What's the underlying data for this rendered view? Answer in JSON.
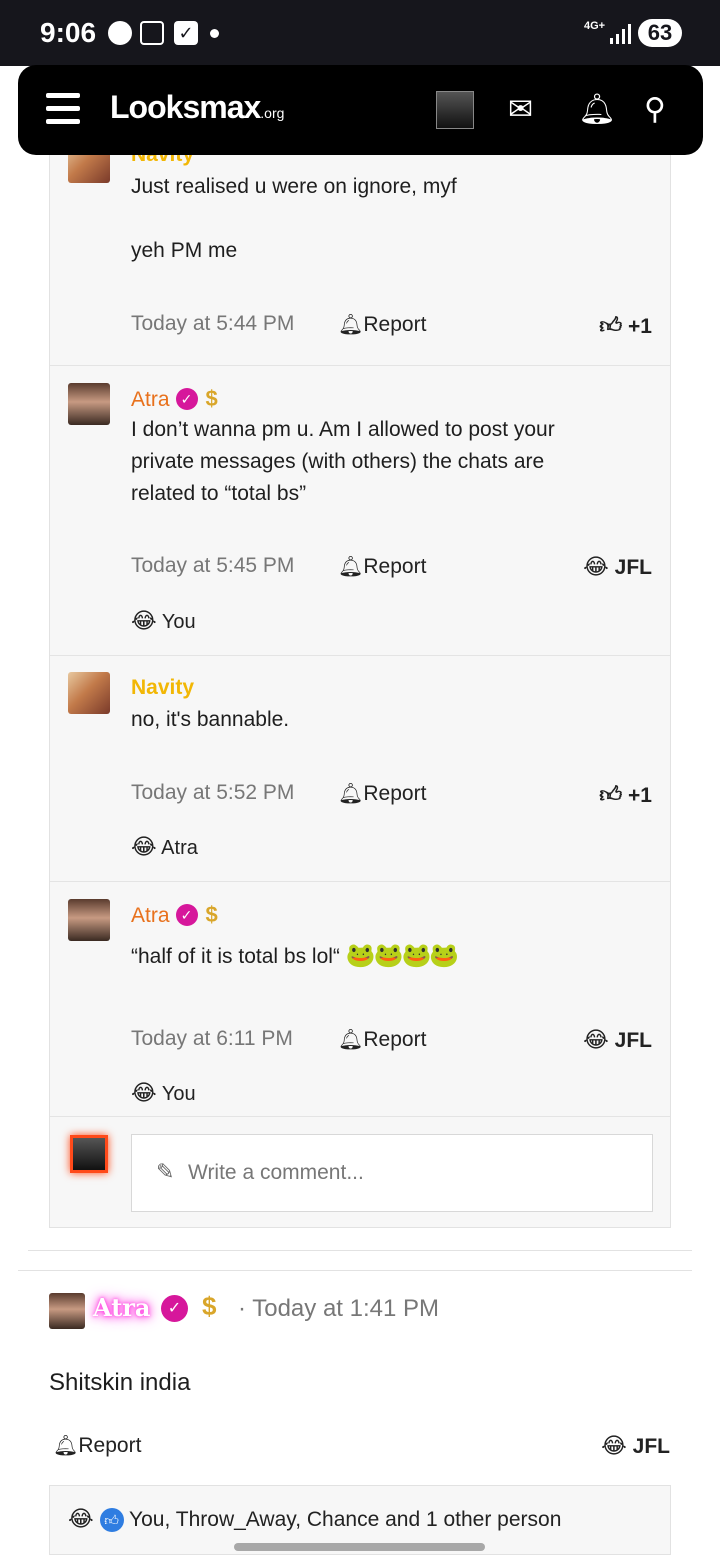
{
  "status_bar": {
    "time": "9:06",
    "network": "4G+",
    "battery": "63"
  },
  "nav": {
    "logo_main": "Looksmax",
    "logo_suffix": ".org",
    "icons": [
      "menu-icon",
      "avatar",
      "envelope-icon",
      "bell-icon",
      "search-icon"
    ]
  },
  "comments": [
    {
      "author": "Navity",
      "body": [
        "Just realised u were on ignore, myf",
        "",
        "yeh PM me"
      ],
      "time": "Today at 5:44 PM",
      "report": "Report",
      "reaction": "+1"
    },
    {
      "author": "Atra",
      "body": [
        "I don’t wanna pm u. Am I allowed to post your",
        "private messages (with others) the chats are",
        "related to “total bs”"
      ],
      "time": "Today at 5:45 PM",
      "report": "Report",
      "reaction": "JFL",
      "reacted_by": "You"
    },
    {
      "author": "Navity",
      "body": [
        "no, it's bannable."
      ],
      "time": "Today at 5:52 PM",
      "report": "Report",
      "reaction": "+1",
      "reacted_by": "Atra"
    },
    {
      "author": "Atra",
      "body": [
        "“half of it is total bs lol“"
      ],
      "time": "Today at 6:11 PM",
      "report": "Report",
      "reaction": "JFL",
      "reacted_by": "You"
    }
  ],
  "write_comment": {
    "placeholder": "Write a comment..."
  },
  "post": {
    "author": "Atra",
    "time": "· Today at 1:41 PM",
    "body": "Shitskin india",
    "report": "Report",
    "reaction": "JFL",
    "reacted_by": "You, Throw_Away, Chance and 1 other person"
  },
  "colors": {
    "navity": "#f2b705",
    "atra": "#e8711c",
    "verified": "#d6179b",
    "glow": "#ff3de0"
  }
}
